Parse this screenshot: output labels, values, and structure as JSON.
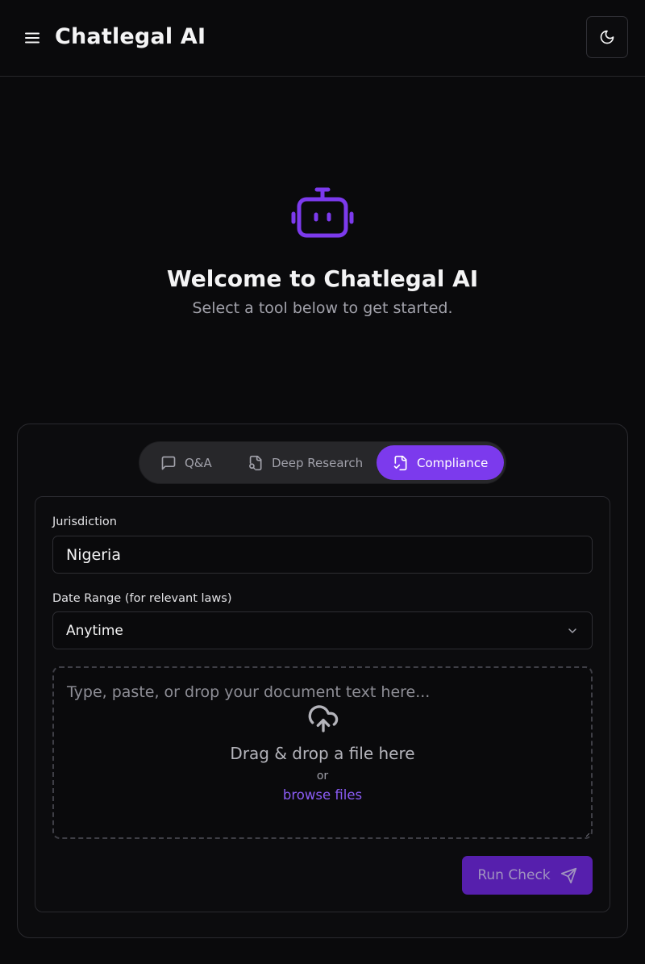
{
  "header": {
    "app_title": "Chatlegal AI",
    "menu_icon": "hamburger-menu-icon",
    "theme_icon": "moon-icon"
  },
  "hero": {
    "icon": "robot-icon",
    "title": "Welcome to Chatlegal AI",
    "subtitle": "Select a tool below to get started."
  },
  "tabs": [
    {
      "label": "Q&A",
      "icon": "chat-bubble-icon",
      "active": false
    },
    {
      "label": "Deep Research",
      "icon": "file-search-icon",
      "active": false
    },
    {
      "label": "Compliance",
      "icon": "file-check-icon",
      "active": true
    }
  ],
  "form": {
    "jurisdiction_label": "Jurisdiction",
    "jurisdiction_value": "Nigeria",
    "date_range_label": "Date Range (for relevant laws)",
    "date_range_value": "Anytime",
    "document_placeholder": "Type, paste, or drop your document text here...",
    "drop_text": "Drag & drop a file here",
    "or_text": "or",
    "browse_text": "browse files",
    "submit_label": "Run Check"
  },
  "colors": {
    "accent": "#7c3aed",
    "link": "#8b5cf6",
    "background": "#0a0a0c"
  }
}
